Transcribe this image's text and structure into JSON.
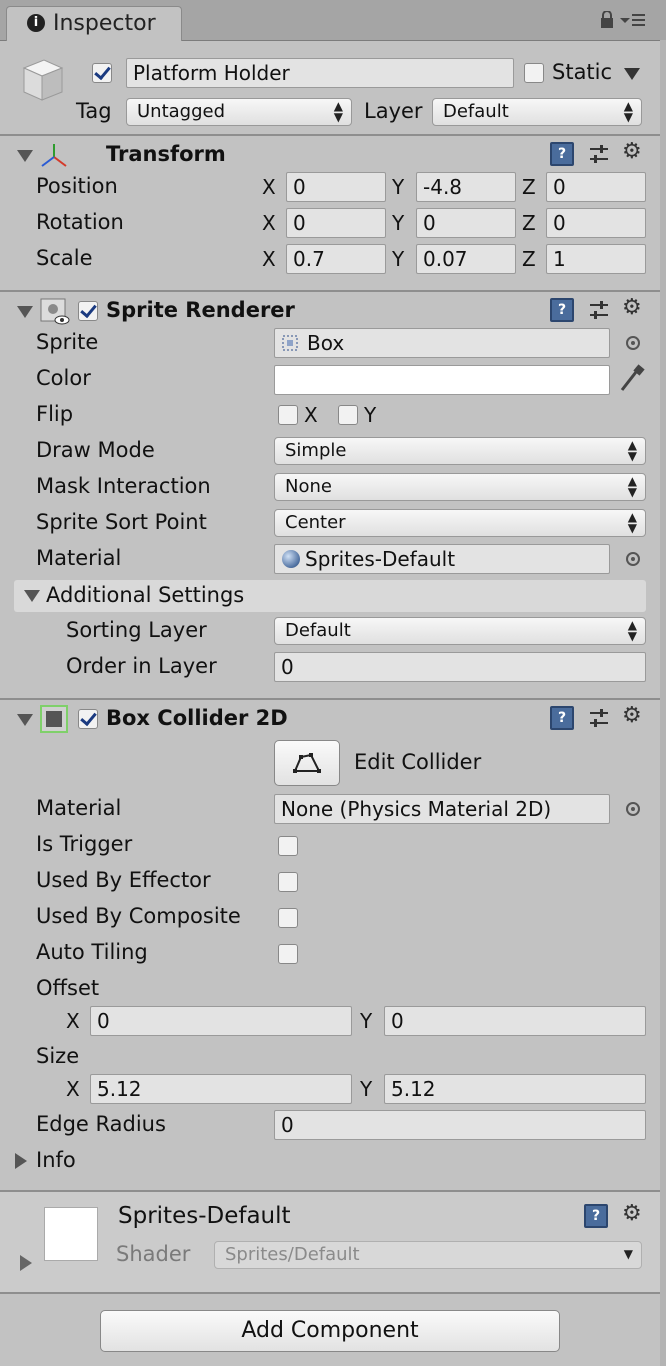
{
  "window": {
    "tab_title": "Inspector"
  },
  "object": {
    "name": "Platform Holder",
    "active": true,
    "static_label": "Static",
    "static_checked": false,
    "tag_label": "Tag",
    "tag_value": "Untagged",
    "layer_label": "Layer",
    "layer_value": "Default"
  },
  "transform": {
    "title": "Transform",
    "rows": [
      {
        "label": "Position",
        "x": "0",
        "y": "-4.8",
        "z": "0"
      },
      {
        "label": "Rotation",
        "x": "0",
        "y": "0",
        "z": "0"
      },
      {
        "label": "Scale",
        "x": "0.7",
        "y": "0.07",
        "z": "1"
      }
    ],
    "axes": {
      "x": "X",
      "y": "Y",
      "z": "Z"
    }
  },
  "sprite_renderer": {
    "title": "Sprite Renderer",
    "enabled": true,
    "sprite_label": "Sprite",
    "sprite_value": "Box",
    "color_label": "Color",
    "color_value": "#ffffff",
    "flip_label": "Flip",
    "flip_x": "X",
    "flip_y": "Y",
    "draw_mode_label": "Draw Mode",
    "draw_mode_value": "Simple",
    "mask_label": "Mask Interaction",
    "mask_value": "None",
    "sort_point_label": "Sprite Sort Point",
    "sort_point_value": "Center",
    "material_label": "Material",
    "material_value": "Sprites-Default",
    "additional_settings": "Additional Settings",
    "sorting_layer_label": "Sorting Layer",
    "sorting_layer_value": "Default",
    "order_label": "Order in Layer",
    "order_value": "0"
  },
  "box_collider": {
    "title": "Box Collider 2D",
    "enabled": true,
    "edit_collider": "Edit Collider",
    "material_label": "Material",
    "material_value": "None (Physics Material 2D)",
    "is_trigger": "Is Trigger",
    "used_by_effector": "Used By Effector",
    "used_by_composite": "Used By Composite",
    "auto_tiling": "Auto Tiling",
    "offset_label": "Offset",
    "offset_x": "0",
    "offset_y": "0",
    "size_label": "Size",
    "size_x": "5.12",
    "size_y": "5.12",
    "edge_radius_label": "Edge Radius",
    "edge_radius_value": "0",
    "info_label": "Info",
    "axes": {
      "x": "X",
      "y": "Y"
    }
  },
  "material_preview": {
    "name": "Sprites-Default",
    "shader_label": "Shader",
    "shader_value": "Sprites/Default"
  },
  "add_component": "Add Component",
  "icons": [
    "info-icon",
    "lock-icon",
    "menu-icon",
    "cube-icon",
    "transform-axes-icon",
    "help-icon",
    "sliders-icon",
    "gear-icon",
    "sprite-icon",
    "picker-icon",
    "eyedropper-icon",
    "polygon-icon",
    "box-collider-icon"
  ]
}
